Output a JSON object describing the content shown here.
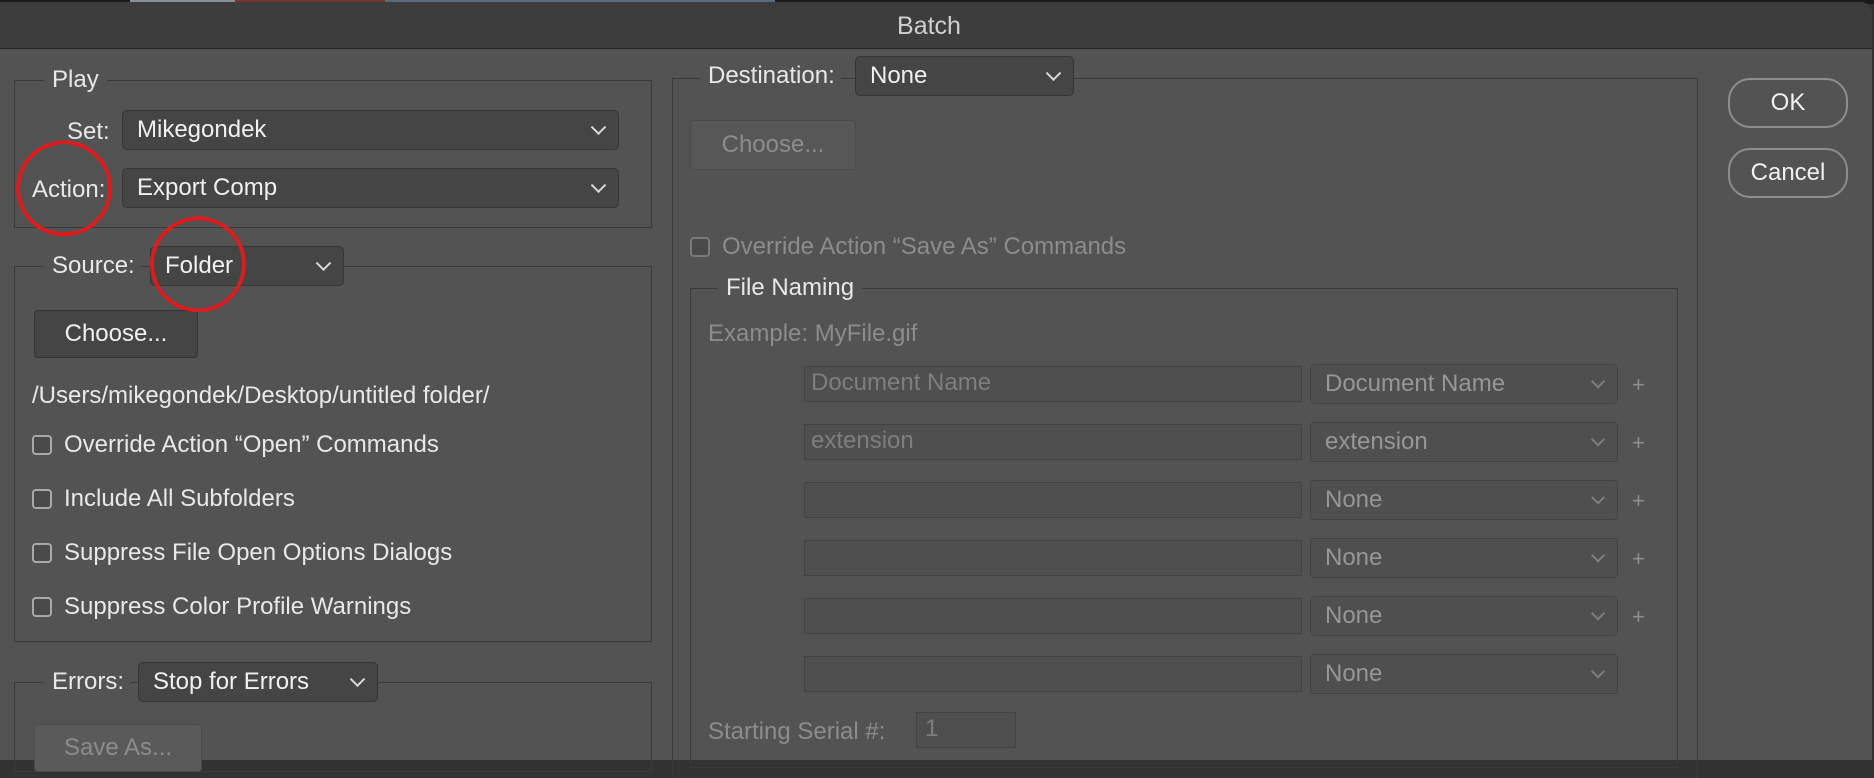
{
  "dialog": {
    "title": "Batch"
  },
  "play": {
    "legend": "Play",
    "set_label": "Set:",
    "set_value": "Mikegondek",
    "action_label": "Action:",
    "action_value": "Export Comp"
  },
  "source": {
    "label": "Source:",
    "value": "Folder",
    "choose_button": "Choose...",
    "path": "/Users/mikegondek/Desktop/untitled folder/",
    "checkboxes": [
      "Override Action “Open” Commands",
      "Include All Subfolders",
      "Suppress File Open Options Dialogs",
      "Suppress Color Profile Warnings"
    ]
  },
  "errors": {
    "label": "Errors:",
    "value": "Stop for Errors",
    "save_as_button": "Save As..."
  },
  "destination": {
    "label": "Destination:",
    "value": "None",
    "choose_button": "Choose...",
    "override_label": "Override Action “Save As” Commands"
  },
  "file_naming": {
    "legend": "File Naming",
    "example": "Example: MyFile.gif",
    "rows": [
      {
        "text_placeholder": "Document Name",
        "select": "Document Name",
        "plus": "+"
      },
      {
        "text_placeholder": "extension",
        "select": "extension",
        "plus": "+"
      },
      {
        "text_placeholder": "",
        "select": "None",
        "plus": "+"
      },
      {
        "text_placeholder": "",
        "select": "None",
        "plus": "+"
      },
      {
        "text_placeholder": "",
        "select": "None",
        "plus": "+"
      },
      {
        "text_placeholder": "",
        "select": "None",
        "plus": ""
      }
    ],
    "serial_label": "Starting Serial #:",
    "serial_value": "1"
  },
  "buttons": {
    "ok": "OK",
    "cancel": "Cancel"
  },
  "colors": {
    "annotation_circle": "#d81e1e",
    "dialog_bg": "#535353"
  }
}
